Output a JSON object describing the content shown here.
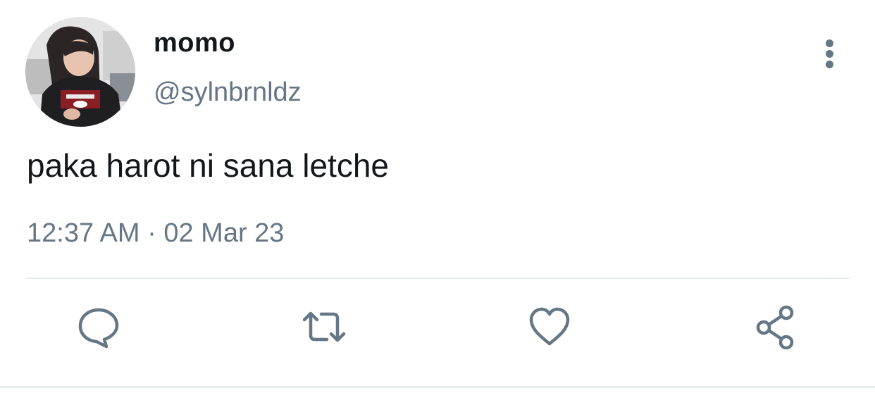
{
  "user": {
    "display_name": "momo",
    "handle": "@sylnbrnldz"
  },
  "tweet": {
    "text": "paka harot ni sana letche",
    "time": "12:37 AM",
    "separator": "·",
    "date": "02 Mar 23"
  },
  "actions": [
    {
      "icon": "reply-icon"
    },
    {
      "icon": "retweet-icon"
    },
    {
      "icon": "like-icon"
    },
    {
      "icon": "share-icon"
    }
  ],
  "colors": {
    "text_primary": "#14171a",
    "text_secondary": "#657786",
    "divider": "#e6ecf0"
  }
}
